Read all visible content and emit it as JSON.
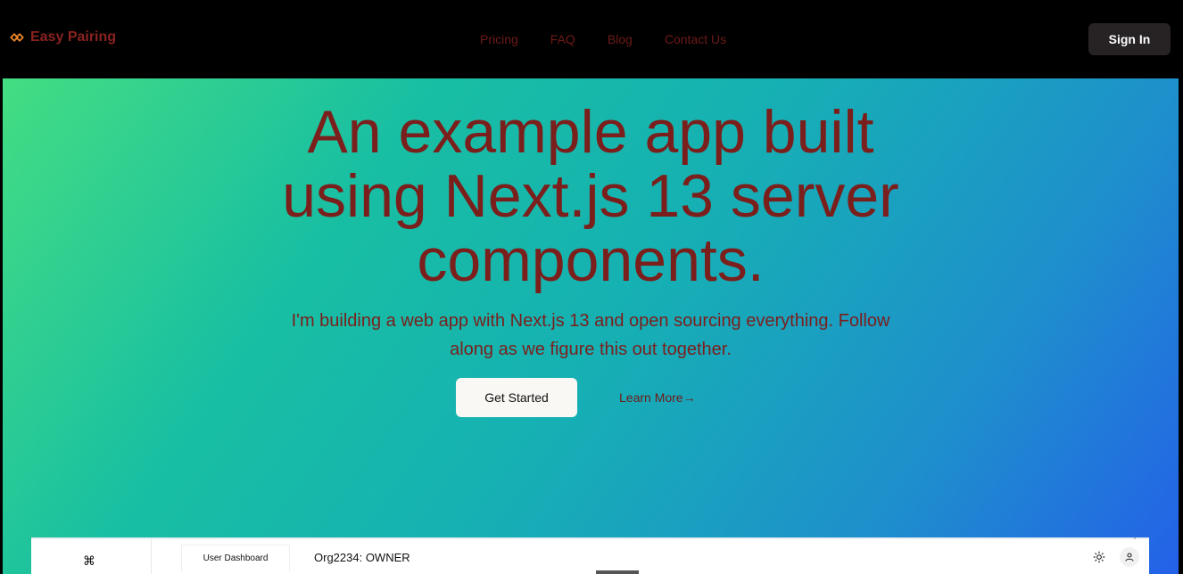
{
  "brand": {
    "name": "Easy Pairing",
    "accent": "#8a2320",
    "logo_icon": "link-chain-icon"
  },
  "nav": {
    "links": [
      "Pricing",
      "FAQ",
      "Blog",
      "Contact Us"
    ],
    "signin_label": "Sign In"
  },
  "hero": {
    "title_lines": [
      "An example app built",
      "using Next.js 13 server",
      "components."
    ],
    "subtitle": "I'm building a web app with Next.js 13 and open sourcing everything. Follow along as we figure this out together.",
    "primary_cta": "Get Started",
    "secondary_cta": "Learn More→"
  },
  "preview": {
    "command_icon": "⌘",
    "tab_label": "User Dashboard",
    "org_label": "Org2234: OWNER",
    "theme_icon": "sun-icon",
    "user_icon": "user-icon"
  },
  "colors": {
    "text_dark_red": "#7b1f1c",
    "gradient": [
      "#44dd82",
      "#18bfa2",
      "#16b0b4",
      "#1e8fcc",
      "#2461e8"
    ]
  }
}
